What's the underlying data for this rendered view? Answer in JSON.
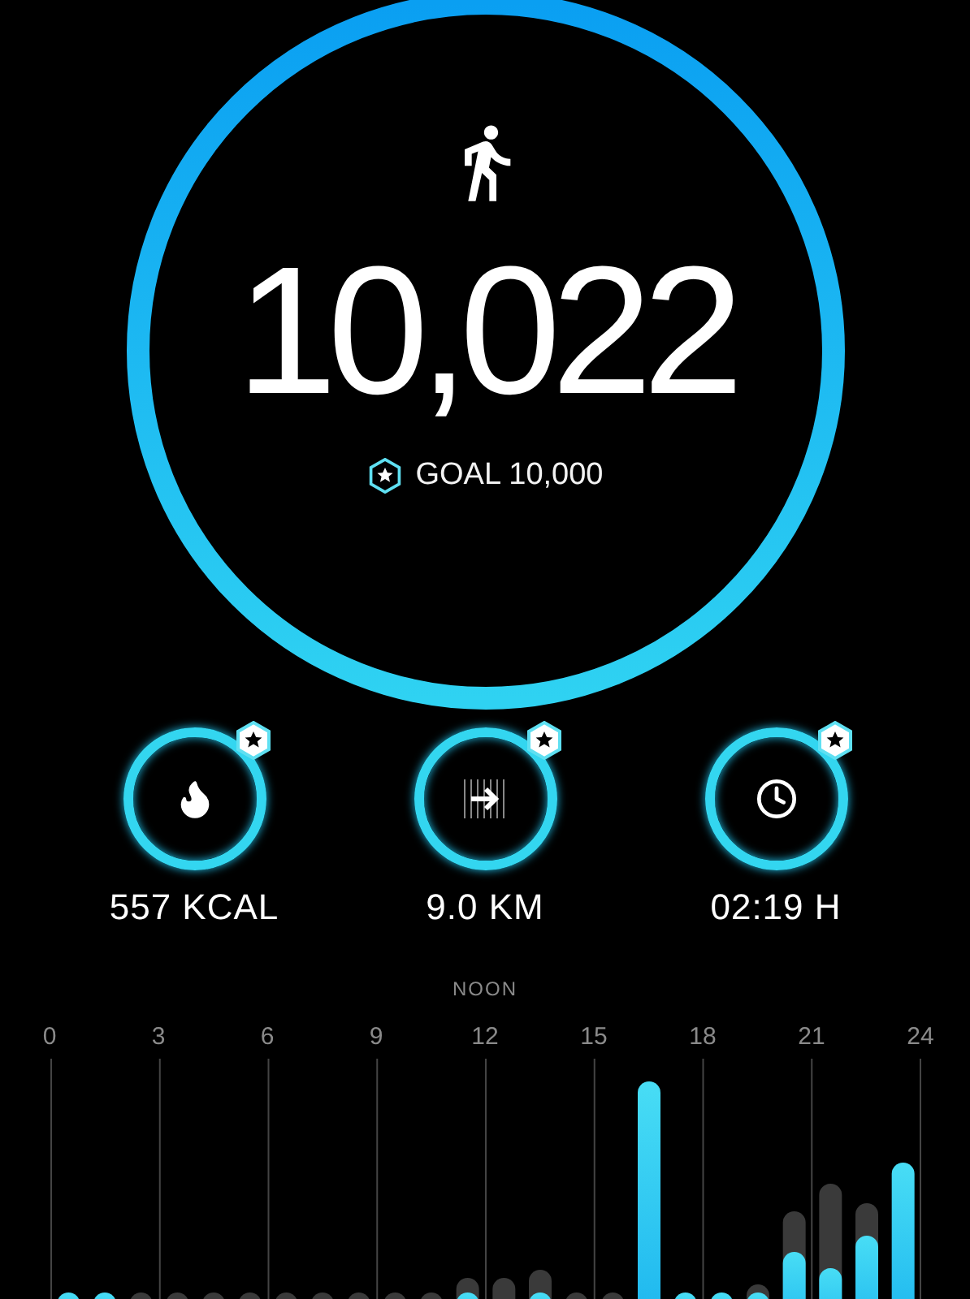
{
  "steps": {
    "value": "10,022",
    "goal": "GOAL 10,000"
  },
  "metrics": [
    {
      "kind": "calories",
      "value": "557 KCAL"
    },
    {
      "kind": "distance",
      "value": "9.0 KM"
    },
    {
      "kind": "duration",
      "value": "02:19 H"
    }
  ],
  "chart": {
    "marker_label": "NOON",
    "hour_labels": [
      "0",
      "3",
      "6",
      "9",
      "12",
      "15",
      "18",
      "21",
      "24"
    ]
  }
}
